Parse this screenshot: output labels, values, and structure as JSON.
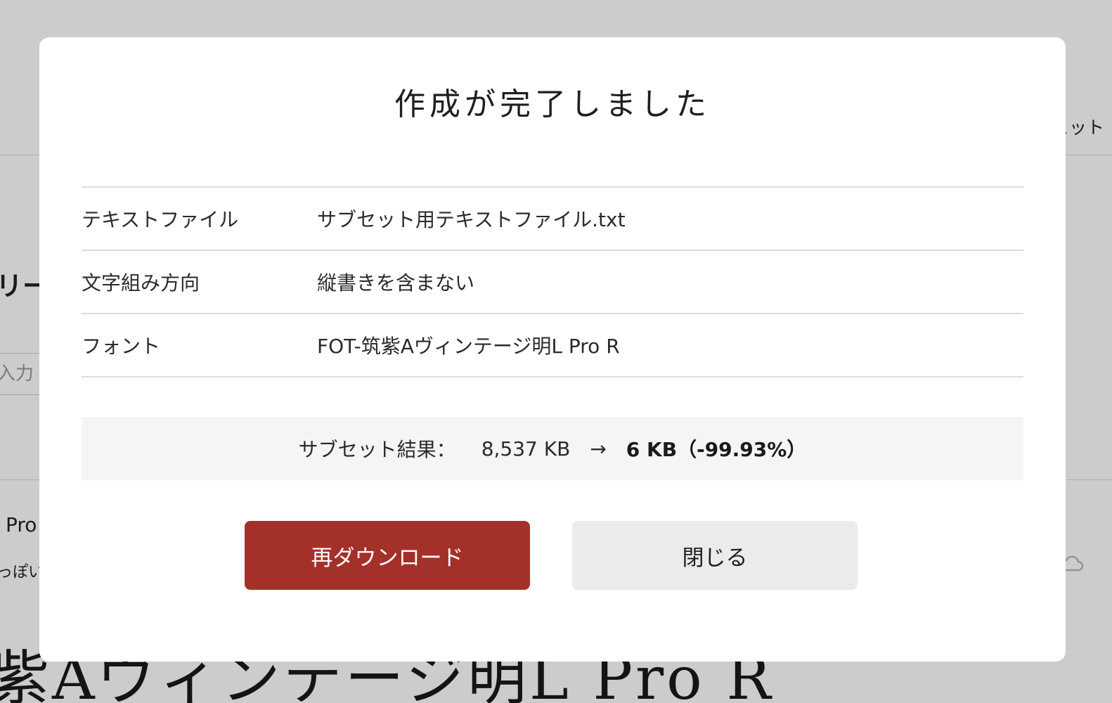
{
  "background": {
    "header_fragment": "ェット",
    "heading_fragment": "リー",
    "input_placeholder_fragment": "入力",
    "font_name_fragment": "Pro",
    "description_fragment": "っぽい",
    "specimen_text": "紫Aヴィンテージ明L Pro R"
  },
  "modal": {
    "title": "作成が完了しました",
    "rows": [
      {
        "label": "テキストファイル",
        "value": "サブセット用テキストファイル.txt"
      },
      {
        "label": "文字組み方向",
        "value": "縦書きを含まない"
      },
      {
        "label": "フォント",
        "value": "FOT-筑紫Aヴィンテージ明L Pro R"
      }
    ],
    "result": {
      "label": "サブセット結果：",
      "before": "8,537 KB",
      "arrow": "→",
      "after": "6 KB（-99.93%）"
    },
    "buttons": {
      "redownload": "再ダウンロード",
      "close": "閉じる"
    }
  },
  "colors": {
    "primary_button": "#a4302a",
    "secondary_button": "#ebebeb",
    "result_background": "#f5f5f5"
  }
}
